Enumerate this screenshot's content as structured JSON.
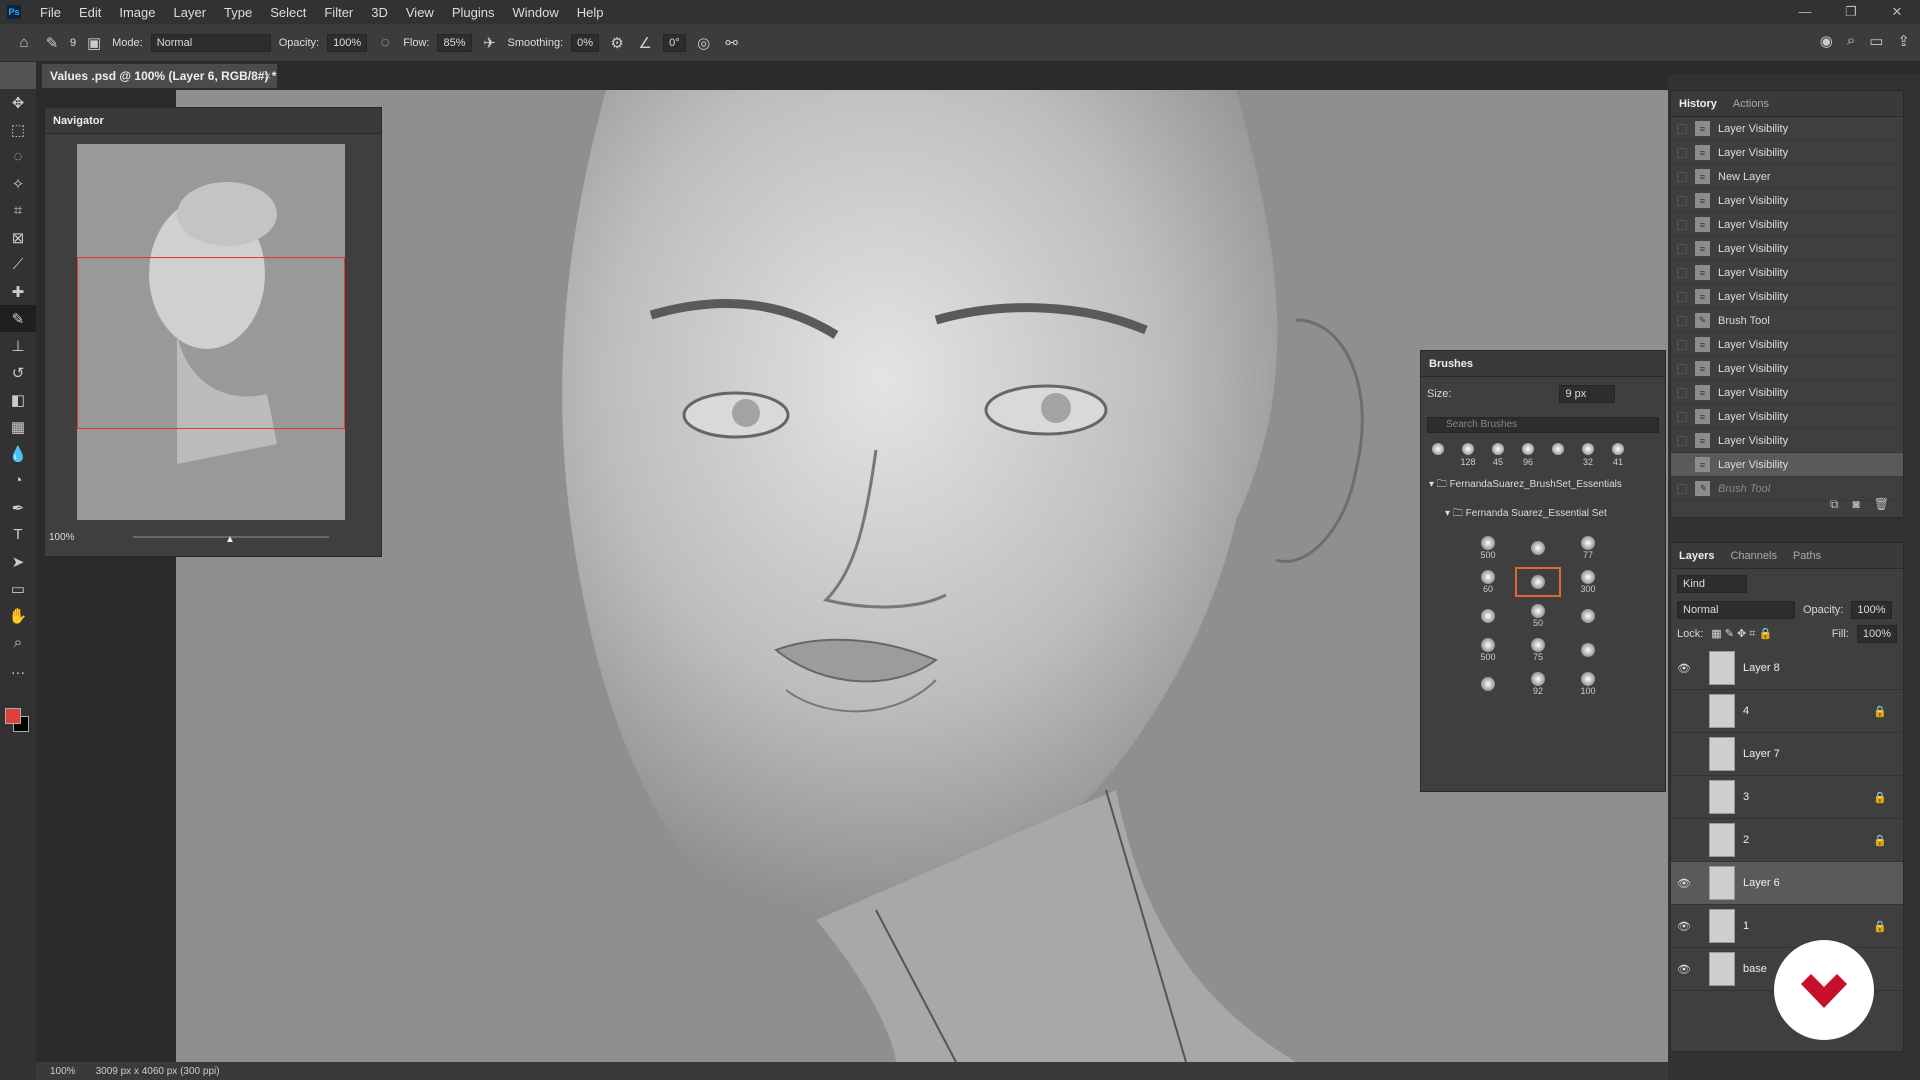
{
  "menubar": {
    "logo": "Ps",
    "items": [
      "File",
      "Edit",
      "Image",
      "Layer",
      "Type",
      "Select",
      "Filter",
      "3D",
      "View",
      "Plugins",
      "Window",
      "Help"
    ]
  },
  "options": {
    "brush_size": "9",
    "mode_label": "Mode:",
    "mode_value": "Normal",
    "opacity_label": "Opacity:",
    "opacity_value": "100%",
    "flow_label": "Flow:",
    "flow_value": "85%",
    "smoothing_label": "Smoothing:",
    "smoothing_value": "0%",
    "angle_value": "0°"
  },
  "document": {
    "tab_title": "Values .psd @ 100% (Layer 6, RGB/8#) *",
    "tab_close": "×"
  },
  "navigator": {
    "title": "Navigator",
    "zoom": "100%"
  },
  "status": {
    "zoom": "100%",
    "doc_size": "3009 px x 4060 px (300 ppi)"
  },
  "history": {
    "tab_active": "History",
    "tab_other": "Actions",
    "items": [
      {
        "label": "Layer Visibility"
      },
      {
        "label": "Layer Visibility"
      },
      {
        "label": "New Layer"
      },
      {
        "label": "Layer Visibility"
      },
      {
        "label": "Layer Visibility"
      },
      {
        "label": "Layer Visibility"
      },
      {
        "label": "Layer Visibility"
      },
      {
        "label": "Layer Visibility"
      },
      {
        "label": "Brush Tool"
      },
      {
        "label": "Layer Visibility"
      },
      {
        "label": "Layer Visibility"
      },
      {
        "label": "Layer Visibility"
      },
      {
        "label": "Layer Visibility"
      },
      {
        "label": "Layer Visibility"
      },
      {
        "label": "Layer Visibility"
      },
      {
        "label": "Brush Tool"
      }
    ]
  },
  "brushes": {
    "title": "Brushes",
    "size_label": "Size:",
    "size_value": "9 px",
    "search_placeholder": "Search Brushes",
    "recent": [
      "",
      "128",
      "45",
      "96",
      "",
      "32",
      "41"
    ],
    "folder": "FernandaSuarez_BrushSet_Essentials",
    "subfolder": "Fernanda Suarez_Essential Set",
    "grid": [
      "500",
      "",
      "77",
      "60",
      "",
      "300",
      "",
      "50",
      "",
      "500",
      "75",
      "",
      "",
      "92",
      "100"
    ]
  },
  "layers": {
    "tabs": [
      "Layers",
      "Channels",
      "Paths"
    ],
    "kind": "Kind",
    "blend": "Normal",
    "opacity_label": "Opacity:",
    "opacity_value": "100%",
    "lock_label": "Lock:",
    "fill_label": "Fill:",
    "fill_value": "100%",
    "items": [
      {
        "name": "Layer 8"
      },
      {
        "name": "4"
      },
      {
        "name": "Layer 7"
      },
      {
        "name": "3"
      },
      {
        "name": "2"
      },
      {
        "name": "Layer 6"
      },
      {
        "name": "1"
      },
      {
        "name": "base"
      }
    ]
  },
  "colors": {
    "foreground": "#e0403a",
    "background": "#000000",
    "brand": "#c8102e"
  }
}
